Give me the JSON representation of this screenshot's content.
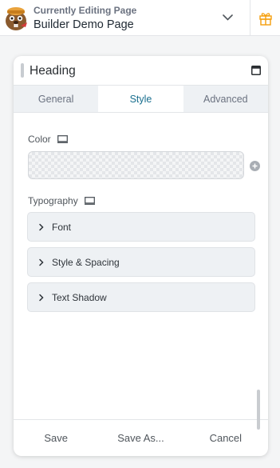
{
  "topbar": {
    "label": "Currently Editing Page",
    "page_name": "Builder Demo Page",
    "logo_icon": "beaver-logo-icon",
    "dropdown_icon": "chevron-down-icon",
    "gift_icon": "gift-icon",
    "accent_color": "#f59e0b"
  },
  "panel": {
    "title": "Heading",
    "tabs": [
      {
        "label": "General",
        "active": false
      },
      {
        "label": "Style",
        "active": true
      },
      {
        "label": "Advanced",
        "active": false
      }
    ],
    "color_field": {
      "label": "Color"
    },
    "typography": {
      "label": "Typography",
      "sections": [
        {
          "label": "Font"
        },
        {
          "label": "Style & Spacing"
        },
        {
          "label": "Text Shadow"
        }
      ]
    },
    "footer": {
      "save": "Save",
      "save_as": "Save As...",
      "cancel": "Cancel"
    }
  }
}
